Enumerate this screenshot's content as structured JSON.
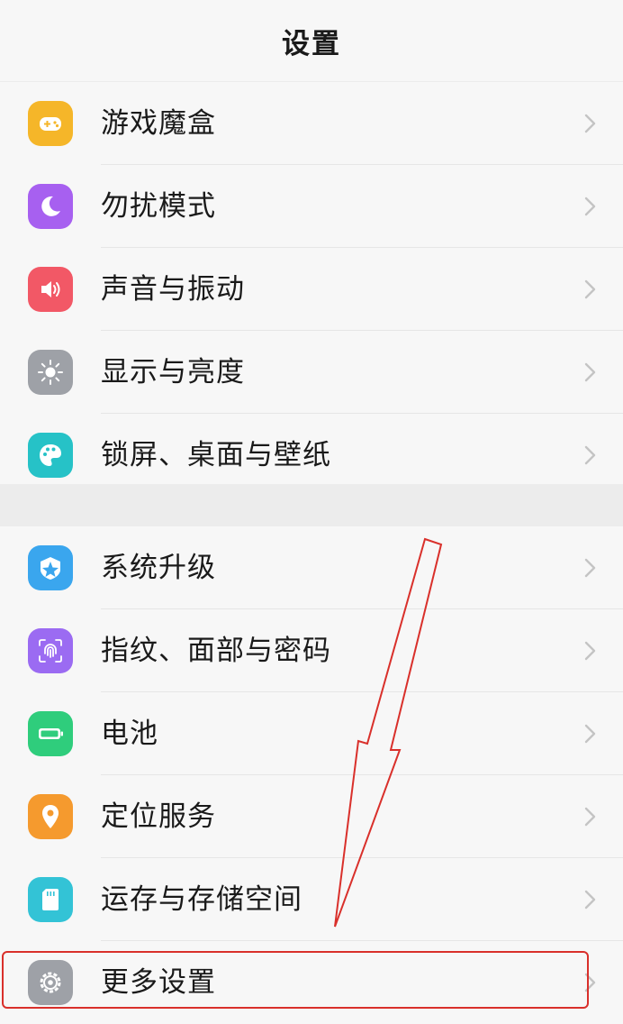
{
  "header": {
    "title": "设置"
  },
  "group1": [
    {
      "label": "游戏魔盒",
      "icon": "gamepad-icon",
      "color": "#f5b629"
    },
    {
      "label": "勿扰模式",
      "icon": "moon-icon",
      "color": "#a760f0"
    },
    {
      "label": "声音与振动",
      "icon": "speaker-icon",
      "color": "#f25866"
    },
    {
      "label": "显示与亮度",
      "icon": "sun-icon",
      "color": "#9ea1a7"
    },
    {
      "label": "锁屏、桌面与壁纸",
      "icon": "palette-icon",
      "color": "#26c2c7"
    }
  ],
  "group2": [
    {
      "label": "系统升级",
      "icon": "system-update-icon",
      "color": "#3aa6ee"
    },
    {
      "label": "指纹、面部与密码",
      "icon": "fingerprint-icon",
      "color": "#9b6bf2"
    },
    {
      "label": "电池",
      "icon": "battery-icon",
      "color": "#2fcd7c"
    },
    {
      "label": "定位服务",
      "icon": "location-pin-icon",
      "color": "#f59a2e"
    },
    {
      "label": "运存与存储空间",
      "icon": "sd-card-icon",
      "color": "#33c3d6"
    },
    {
      "label": "更多设置",
      "icon": "gear-icon",
      "color": "#9ea1a7"
    }
  ],
  "annotation": {
    "color": "#d9302b"
  }
}
